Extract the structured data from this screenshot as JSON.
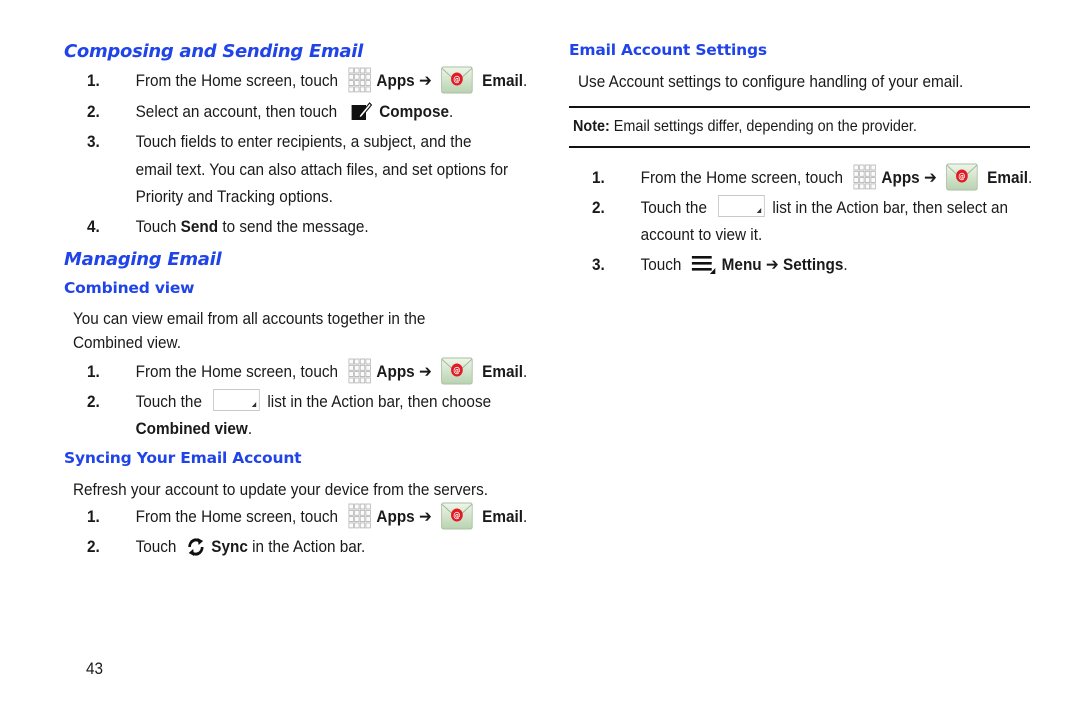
{
  "left": {
    "composing": {
      "title": "Composing and Sending Email",
      "steps": [
        {
          "num": "1.",
          "pre": "From the Home screen, touch",
          "apps": "Apps",
          "arrow": "➔",
          "email": "Email",
          "end": "."
        },
        {
          "num": "2.",
          "pre": "Select an account, then touch",
          "bold": "Compose",
          "end": "."
        },
        {
          "num": "3.",
          "lines": [
            "Touch fields to enter recipients, a subject, and the",
            "email text. You can also attach files, and set options for",
            "Priority and Tracking options."
          ]
        },
        {
          "num": "4.",
          "pre": "Touch ",
          "bold": "Send",
          "post": " to send the message."
        }
      ]
    },
    "managing": {
      "title": "Managing Email",
      "combined": {
        "title": "Combined view",
        "intro": [
          "You can view email from all accounts together in the",
          "Combined view."
        ],
        "steps": [
          {
            "num": "1.",
            "pre": "From the Home screen, touch",
            "apps": "Apps",
            "arrow": "➔",
            "email": "Email",
            "end": "."
          },
          {
            "num": "2.",
            "pre": "Touch the",
            "post": "list in the Action bar, then choose",
            "bold_line": "Combined view",
            "end": "."
          }
        ]
      },
      "syncing": {
        "title": "Syncing Your Email Account",
        "intro": "Refresh your account to update your device from the servers.",
        "steps": [
          {
            "num": "1.",
            "pre": "From the Home screen, touch",
            "apps": "Apps",
            "arrow": "➔",
            "email": "Email",
            "end": "."
          },
          {
            "num": "2.",
            "pre": "Touch",
            "bold": "Sync",
            "post": " in the Action bar."
          }
        ]
      }
    },
    "page_number": "43"
  },
  "right": {
    "settings": {
      "title": "Email Account Settings",
      "intro": "Use Account settings to configure handling of your email.",
      "note_label": "Note:",
      "note_text": " Email settings differ, depending on the provider.",
      "steps": [
        {
          "num": "1.",
          "pre": "From the Home screen, touch",
          "apps": "Apps",
          "arrow": "➔",
          "email": "Email",
          "end": "."
        },
        {
          "num": "2.",
          "pre": "Touch the",
          "post": "list in the Action bar, then select an",
          "line2": "account to view it."
        },
        {
          "num": "3.",
          "pre": "Touch",
          "bold": "Menu",
          "arrow": "➔",
          "bold2": "Settings",
          "end": "."
        }
      ]
    }
  },
  "icons": {
    "apps": "apps-grid-icon",
    "email": "email-envelope-icon",
    "compose": "compose-icon",
    "sync": "sync-icon",
    "menu": "menu-icon",
    "dropdown": "account-dropdown-icon"
  },
  "colors": {
    "heading": "#2044e8",
    "text": "#1a1a1a",
    "email_badge": "#e01b24"
  }
}
